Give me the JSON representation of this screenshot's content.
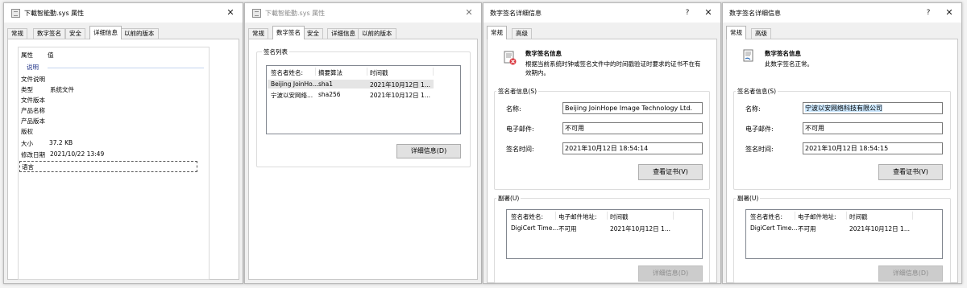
{
  "win1": {
    "title": "下載智能動.sys 属性",
    "tabs": [
      "常规",
      "数字签名",
      "安全",
      "详细信息",
      "以前的版本"
    ],
    "active_tab": "详细信息",
    "props": {
      "header_name": "属性",
      "header_value": "值",
      "section": "说明",
      "rows": [
        {
          "name": "文件说明",
          "value": ""
        },
        {
          "name": "类型",
          "value": "系统文件"
        },
        {
          "name": "文件版本",
          "value": ""
        },
        {
          "name": "产品名称",
          "value": ""
        },
        {
          "name": "产品版本",
          "value": ""
        },
        {
          "name": "版权",
          "value": ""
        },
        {
          "name": "大小",
          "value": "37.2 KB"
        },
        {
          "name": "修改日期",
          "value": "2021/10/22 13:49"
        },
        {
          "name": "语言",
          "value": ""
        }
      ]
    }
  },
  "win2": {
    "title": "下載智能動.sys 属性",
    "tabs": [
      "常规",
      "数字签名",
      "安全",
      "详细信息",
      "以前的版本"
    ],
    "active_tab": "数字签名",
    "group_label": "签名列表",
    "columns": [
      "签名者姓名:",
      "摘要算法",
      "时间戳"
    ],
    "rows": [
      [
        "Beijing JoinHo...",
        "sha1",
        "2021年10月12日 1..."
      ],
      [
        "宁波以安网络...",
        "sha256",
        "2021年10月12日 1..."
      ]
    ],
    "details_button": "详细信息(D)"
  },
  "win3": {
    "title": "数字签名详细信息",
    "tabs": [
      "常规",
      "高级"
    ],
    "active_tab": "常规",
    "info_heading": "数字签名信息",
    "info_text_line1": "根据当前系统时钟或签名文件中的时间戳验证时要求的证书不在有",
    "info_text_line2": "效期内。",
    "signer_group": "签名者信息(S)",
    "name_label": "名称:",
    "name_value": "Beijing JoinHope Image Technology Ltd.",
    "email_label": "电子邮件:",
    "email_value": "不可用",
    "time_label": "签名时间:",
    "time_value": "2021年10月12日 18:54:14",
    "view_cert_button": "查看证书(V)",
    "countersig_group": "副署(U)",
    "cs_columns": [
      "签名者姓名:",
      "电子邮件地址:",
      "时间戳"
    ],
    "cs_rows": [
      [
        "DigiCert Time...",
        "不可用",
        "2021年10月12日 1..."
      ]
    ],
    "details_button": "详细信息(D)"
  },
  "win4": {
    "title": "数字签名详细信息",
    "tabs": [
      "常规",
      "高级"
    ],
    "active_tab": "常规",
    "info_heading": "数字签名信息",
    "info_text_line1": "此数字签名正常。",
    "signer_group": "签名者信息(S)",
    "name_label": "名称:",
    "name_value": "宁波以安网络科技有限公司",
    "email_label": "电子邮件:",
    "email_value": "不可用",
    "time_label": "签名时间:",
    "time_value": "2021年10月12日 18:54:15",
    "view_cert_button": "查看证书(V)",
    "countersig_group": "副署(U)",
    "cs_columns": [
      "签名者姓名:",
      "电子邮件地址:",
      "时间戳"
    ],
    "cs_rows": [
      [
        "DigiCert Time...",
        "不可用",
        "2021年10月12日 1..."
      ]
    ],
    "details_button": "详细信息(D)"
  }
}
